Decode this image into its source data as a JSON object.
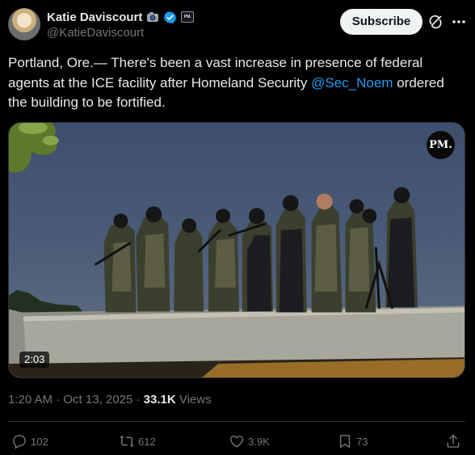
{
  "author": {
    "display_name": "Katie Daviscourt",
    "handle": "@KatieDaviscourt",
    "affiliate_badge_text": "PM."
  },
  "header": {
    "subscribe_label": "Subscribe"
  },
  "tweet": {
    "text_before": "Portland, Ore.— There's been a vast increase in presence of federal agents at the ICE facility after Homeland Security ",
    "mention": "@Sec_Noem",
    "text_after": " ordered the building to be fortified."
  },
  "media": {
    "logo_text": "PM.",
    "duration": "2:03"
  },
  "meta": {
    "time": "1:20 AM",
    "separator": "·",
    "date": "Oct 13, 2025",
    "views_count": "33.1K",
    "views_label": "Views"
  },
  "actions": {
    "replies": "102",
    "reposts": "612",
    "likes": "3.9K",
    "bookmarks": "73"
  },
  "colors": {
    "background": "#000000",
    "text": "#e7e9ea",
    "secondary": "#71767b",
    "link": "#1d9bf0",
    "verified": "#1d9bf0"
  },
  "icons": [
    "camera-icon",
    "verified-icon",
    "grok-icon",
    "more-icon",
    "reply-icon",
    "repost-icon",
    "like-icon",
    "bookmark-icon",
    "share-icon"
  ]
}
